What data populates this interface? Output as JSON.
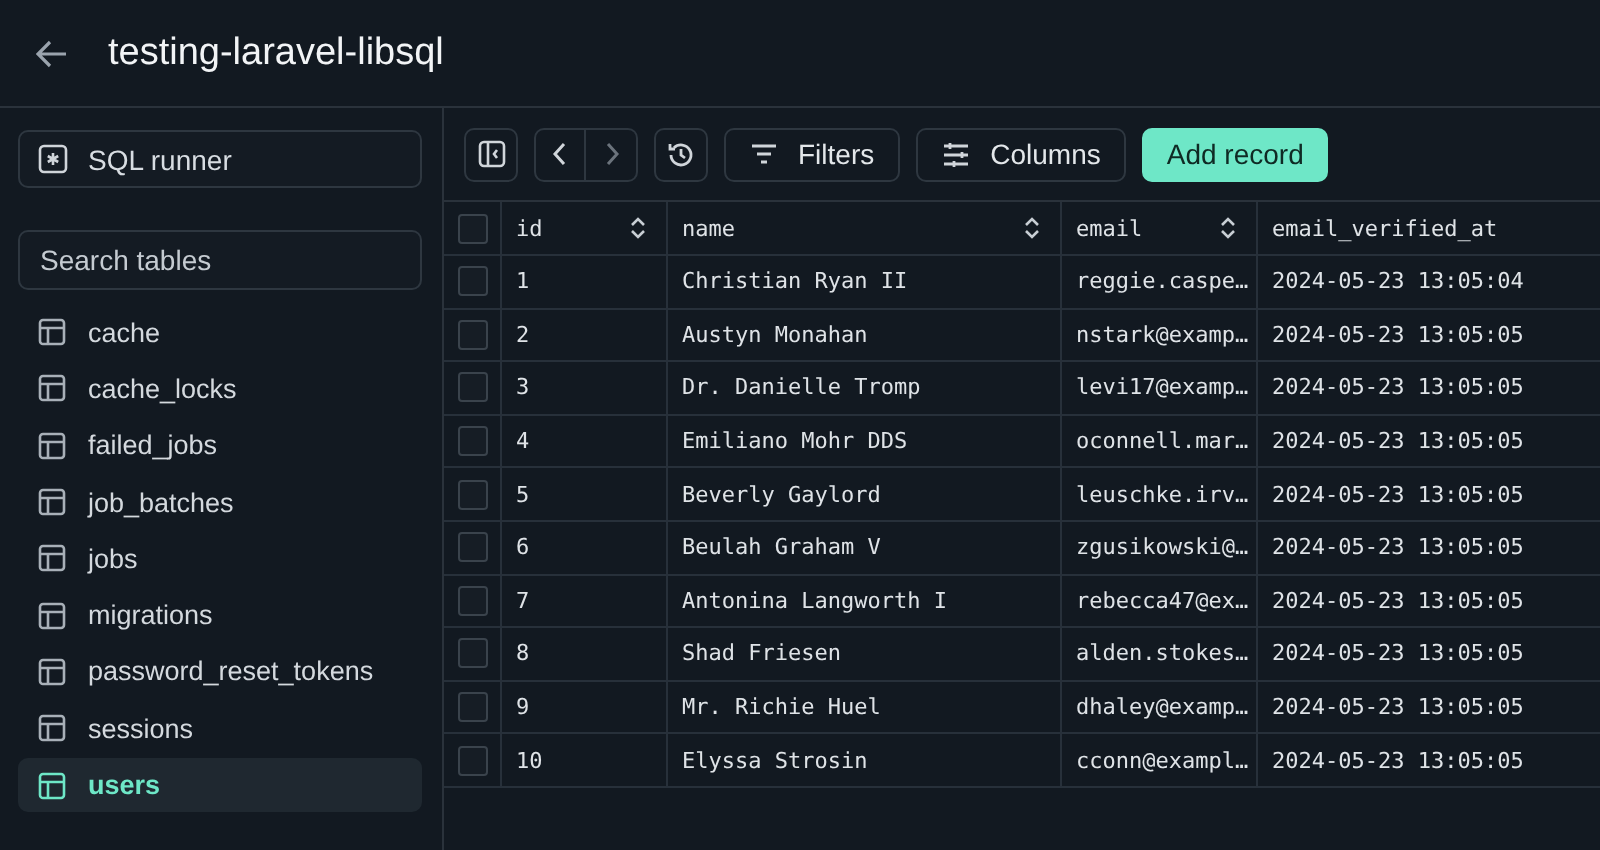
{
  "header": {
    "title": "testing-laravel-libsql"
  },
  "sidebar": {
    "sql_runner": "SQL runner",
    "search": {
      "placeholder": "Search tables"
    },
    "items": [
      {
        "label": "cache",
        "selected": false
      },
      {
        "label": "cache_locks",
        "selected": false
      },
      {
        "label": "failed_jobs",
        "selected": false
      },
      {
        "label": "job_batches",
        "selected": false
      },
      {
        "label": "jobs",
        "selected": false
      },
      {
        "label": "migrations",
        "selected": false
      },
      {
        "label": "password_reset_tokens",
        "selected": false
      },
      {
        "label": "sessions",
        "selected": false
      },
      {
        "label": "users",
        "selected": true
      }
    ]
  },
  "toolbar": {
    "filters": "Filters",
    "columns": "Columns",
    "add_record": "Add record"
  },
  "table": {
    "select_all_checked": false,
    "columns": [
      {
        "label": "id",
        "sortable": true
      },
      {
        "label": "name",
        "sortable": true
      },
      {
        "label": "email",
        "sortable": true
      },
      {
        "label": "email_verified_at",
        "sortable": false
      }
    ],
    "rows": [
      {
        "checked": false,
        "cells": [
          "1",
          "Christian Ryan II",
          "reggie.caspe…",
          "2024-05-23 13:05:04"
        ]
      },
      {
        "checked": false,
        "cells": [
          "2",
          "Austyn Monahan",
          "nstark@examp…",
          "2024-05-23 13:05:05"
        ]
      },
      {
        "checked": false,
        "cells": [
          "3",
          "Dr. Danielle Tromp",
          "levi17@examp…",
          "2024-05-23 13:05:05"
        ]
      },
      {
        "checked": false,
        "cells": [
          "4",
          "Emiliano Mohr DDS",
          "oconnell.mar…",
          "2024-05-23 13:05:05"
        ]
      },
      {
        "checked": false,
        "cells": [
          "5",
          "Beverly Gaylord",
          "leuschke.irv…",
          "2024-05-23 13:05:05"
        ]
      },
      {
        "checked": false,
        "cells": [
          "6",
          "Beulah Graham V",
          "zgusikowski@…",
          "2024-05-23 13:05:05"
        ]
      },
      {
        "checked": false,
        "cells": [
          "7",
          "Antonina Langworth I",
          "rebecca47@ex…",
          "2024-05-23 13:05:05"
        ]
      },
      {
        "checked": false,
        "cells": [
          "8",
          "Shad Friesen",
          "alden.stokes…",
          "2024-05-23 13:05:05"
        ]
      },
      {
        "checked": false,
        "cells": [
          "9",
          "Mr. Richie Huel",
          "dhaley@examp…",
          "2024-05-23 13:05:05"
        ]
      },
      {
        "checked": false,
        "cells": [
          "10",
          "Elyssa Strosin",
          "cconn@exampl…",
          "2024-05-23 13:05:05"
        ]
      }
    ]
  }
}
